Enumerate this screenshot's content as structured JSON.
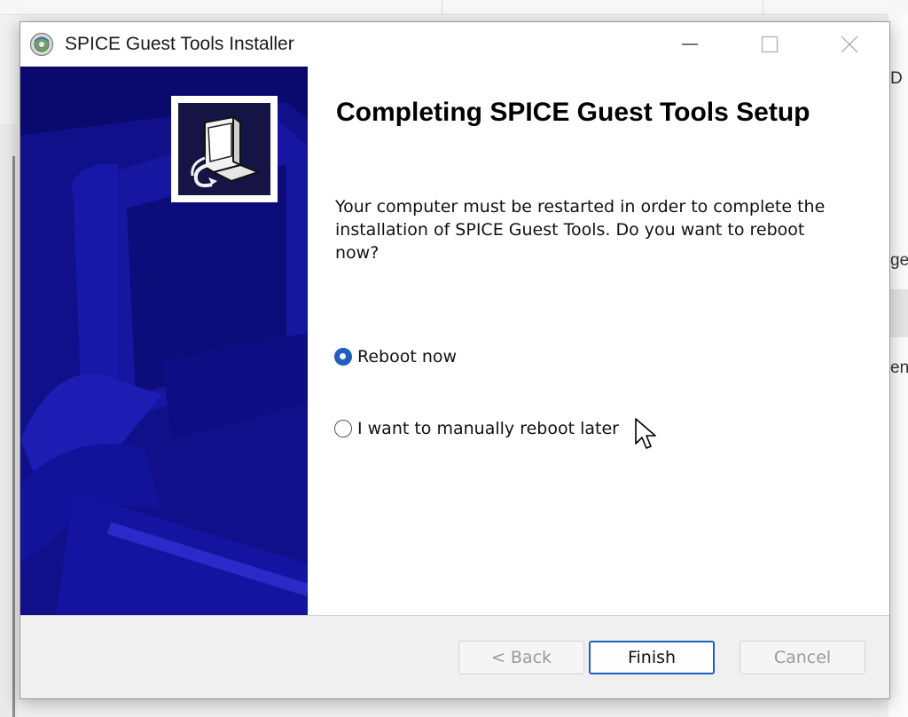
{
  "background": {
    "right_texts": [
      "D",
      "ge",
      "ent"
    ]
  },
  "window": {
    "title": "SPICE Guest Tools Installer",
    "icon": "installer-disc-icon",
    "controls": [
      "minimize-icon",
      "maximize-icon",
      "close-icon"
    ]
  },
  "page": {
    "heading": "Completing SPICE Guest Tools Setup",
    "message": "Your computer must be restarted in order to complete the installation of SPICE Guest Tools. Do you want to reboot now?",
    "options": [
      {
        "label": "Reboot now",
        "selected": true
      },
      {
        "label": "I want to manually reboot later",
        "selected": false
      }
    ]
  },
  "buttons": {
    "back": {
      "label": "< Back",
      "enabled": false
    },
    "finish": {
      "label": "Finish",
      "enabled": true,
      "default": true
    },
    "cancel": {
      "label": "Cancel",
      "enabled": false
    }
  },
  "colors": {
    "side_panel": "#0a0a6e",
    "accent": "#1f5fbf"
  }
}
